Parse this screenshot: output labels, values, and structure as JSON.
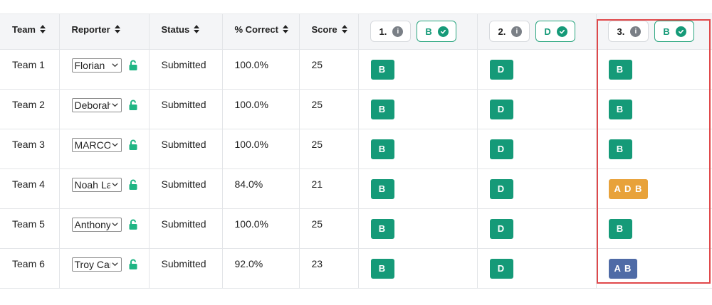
{
  "colors": {
    "correct": "#159a78",
    "partial": "#e8a23a",
    "wrong": "#4f6ba6",
    "highlight": "#e0484a"
  },
  "headers": {
    "team": "Team",
    "reporter": "Reporter",
    "status": "Status",
    "percent_correct": "% Correct",
    "score": "Score"
  },
  "questions": [
    {
      "number": "1.",
      "answer": "B"
    },
    {
      "number": "2.",
      "answer": "D"
    },
    {
      "number": "3.",
      "answer": "B"
    }
  ],
  "rows": [
    {
      "team": "Team 1",
      "reporter": "Florian",
      "status": "Submitted",
      "percent": "100.0%",
      "score": "25",
      "answers": [
        {
          "text": "B",
          "state": "correct"
        },
        {
          "text": "D",
          "state": "correct"
        },
        {
          "text": "B",
          "state": "correct"
        }
      ]
    },
    {
      "team": "Team 2",
      "reporter": "Deborah",
      "status": "Submitted",
      "percent": "100.0%",
      "score": "25",
      "answers": [
        {
          "text": "B",
          "state": "correct"
        },
        {
          "text": "D",
          "state": "correct"
        },
        {
          "text": "B",
          "state": "correct"
        }
      ]
    },
    {
      "team": "Team 3",
      "reporter": "MARCO",
      "status": "Submitted",
      "percent": "100.0%",
      "score": "25",
      "answers": [
        {
          "text": "B",
          "state": "correct"
        },
        {
          "text": "D",
          "state": "correct"
        },
        {
          "text": "B",
          "state": "correct"
        }
      ]
    },
    {
      "team": "Team 4",
      "reporter": "Noah La",
      "status": "Submitted",
      "percent": "84.0%",
      "score": "21",
      "answers": [
        {
          "text": "B",
          "state": "correct"
        },
        {
          "text": "D",
          "state": "correct"
        },
        {
          "text": "A D B",
          "state": "partial"
        }
      ]
    },
    {
      "team": "Team 5",
      "reporter": "Anthony",
      "status": "Submitted",
      "percent": "100.0%",
      "score": "25",
      "answers": [
        {
          "text": "B",
          "state": "correct"
        },
        {
          "text": "D",
          "state": "correct"
        },
        {
          "text": "B",
          "state": "correct"
        }
      ]
    },
    {
      "team": "Team 6",
      "reporter": "Troy Car",
      "status": "Submitted",
      "percent": "92.0%",
      "score": "23",
      "answers": [
        {
          "text": "B",
          "state": "correct"
        },
        {
          "text": "D",
          "state": "correct"
        },
        {
          "text": "A B",
          "state": "wrong"
        }
      ]
    }
  ]
}
